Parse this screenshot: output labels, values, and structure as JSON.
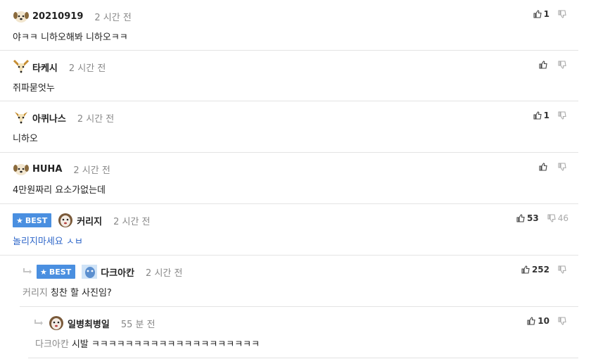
{
  "comments": [
    {
      "nick": "20210919",
      "time": "2 시간 전",
      "text": "야ㅋㅋ 니하오해봐 니하오ㅋㅋ",
      "up": "1",
      "down": ""
    },
    {
      "nick": "타케시",
      "time": "2 시간 전",
      "text": "쥐파묻엇누",
      "up": "",
      "down": ""
    },
    {
      "nick": "아퀴나스",
      "time": "2 시간 전",
      "text": "니하오",
      "up": "1",
      "down": ""
    },
    {
      "nick": "HUHA",
      "time": "2 시간 전",
      "text": "4만원짜리 요소가없는데",
      "up": "",
      "down": ""
    },
    {
      "badge": "BEST",
      "nick": "커리지",
      "time": "2 시간 전",
      "text": "놀리지마세요 ㅅㅂ",
      "up": "53",
      "down": "46"
    },
    {
      "badge": "BEST",
      "nick": "다크아칸",
      "time": "2 시간 전",
      "mention": "커리지",
      "text": "칭찬 할 사진임?",
      "up": "252",
      "down": ""
    },
    {
      "nick": "일병최병일",
      "time": "55 분 전",
      "mention": "다크아칸",
      "text": "시발 ㅋㅋㅋㅋㅋㅋㅋㅋㅋㅋㅋㅋㅋㅋㅋㅋㅋㅋㅋㅋ",
      "up": "10",
      "down": ""
    }
  ],
  "icons": {
    "thumbs_up": "thumbs-up-icon",
    "thumbs_down": "thumbs-down-icon",
    "reply": "reply-arrow-icon",
    "star": "star-icon"
  },
  "colors": {
    "best_badge": "#4a8fe0",
    "mention_text": "#2f67c9"
  }
}
